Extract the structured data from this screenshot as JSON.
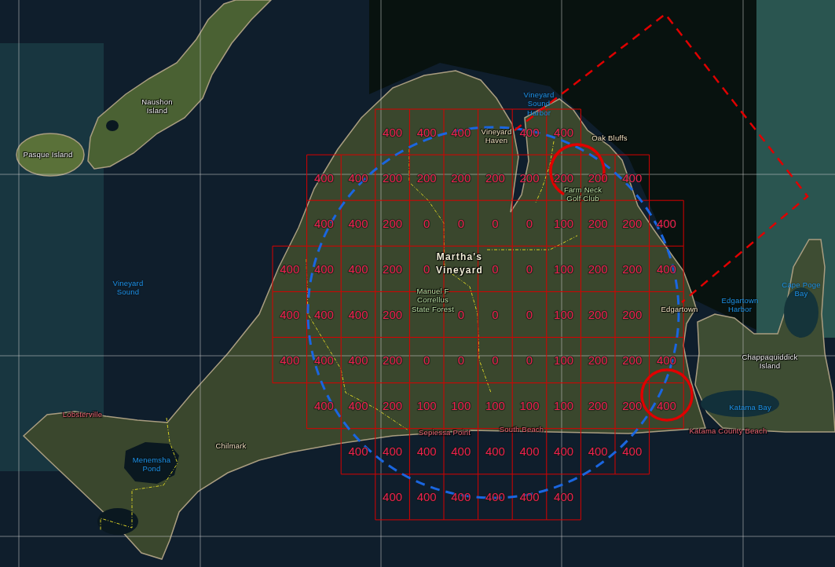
{
  "map": {
    "labels": [
      {
        "text": "Naushon\nIsland",
        "kind": "island"
      },
      {
        "text": "Vineyard\nSound\nHarbor",
        "kind": "water"
      },
      {
        "text": "Vineyard\nHaven",
        "kind": "town"
      },
      {
        "text": "Oak Bluffs",
        "kind": "town"
      },
      {
        "text": "Pasque Island",
        "kind": "island"
      },
      {
        "text": "Farm Neck\nGolf Club",
        "kind": "park"
      },
      {
        "text": "Martha's\nVineyard",
        "kind": "region"
      },
      {
        "text": "Vineyard\nSound",
        "kind": "water"
      },
      {
        "text": "Manuel F\nCorrellus\nState Forest",
        "kind": "park"
      },
      {
        "text": "Edgartown",
        "kind": "town"
      },
      {
        "text": "Edgartown\nHarbor",
        "kind": "water"
      },
      {
        "text": "Cape Poge\nBay",
        "kind": "water"
      },
      {
        "text": "Chappaquiddick\nIsland",
        "kind": "island"
      },
      {
        "text": "Lobsterville",
        "kind": "beach"
      },
      {
        "text": "Katama Bay",
        "kind": "water"
      },
      {
        "text": "Sepiessa Point",
        "kind": "beach"
      },
      {
        "text": "South Beach",
        "kind": "beach"
      },
      {
        "text": "Katama County Beach",
        "kind": "beach"
      },
      {
        "text": "Chilmark",
        "kind": "town"
      },
      {
        "text": "Menemsha\nPond",
        "kind": "water"
      }
    ],
    "grid": {
      "rows": [
        [
          "",
          "",
          "",
          "400",
          "400",
          "400",
          null,
          "400",
          "400",
          "",
          "",
          ""
        ],
        [
          "",
          "400",
          "400",
          "200",
          "200",
          "200",
          "200",
          "200",
          "200",
          "200",
          "400",
          ""
        ],
        [
          "",
          "400",
          "400",
          "200",
          "0",
          "0",
          "0",
          "0",
          "100",
          "200",
          "200",
          "400"
        ],
        [
          "400",
          "400",
          "400",
          "200",
          "0",
          null,
          "0",
          "0",
          "100",
          "200",
          "200",
          "400"
        ],
        [
          "400",
          "400",
          "400",
          "200",
          null,
          "0",
          "0",
          "0",
          "100",
          "200",
          "200",
          null
        ],
        [
          "400",
          "400",
          "400",
          "200",
          "0",
          "0",
          "0",
          "0",
          "100",
          "200",
          "200",
          "400"
        ],
        [
          "",
          "400",
          "400",
          "200",
          "100",
          "100",
          "100",
          "100",
          "100",
          "200",
          "200",
          "400"
        ],
        [
          "",
          "",
          "400",
          "400",
          "400",
          "400",
          "400",
          "400",
          "400",
          "400",
          "400",
          ""
        ],
        [
          "",
          "",
          "",
          "400",
          "400",
          "400",
          "400",
          "400",
          "400",
          "",
          "",
          ""
        ]
      ]
    },
    "overlays": [
      {
        "kind": "range-ring",
        "color": "#1a66e0"
      },
      {
        "kind": "marker-ring",
        "color": "#e00000"
      },
      {
        "kind": "marker-ring",
        "color": "#e00000"
      },
      {
        "kind": "route",
        "color": "#e00000"
      }
    ]
  }
}
